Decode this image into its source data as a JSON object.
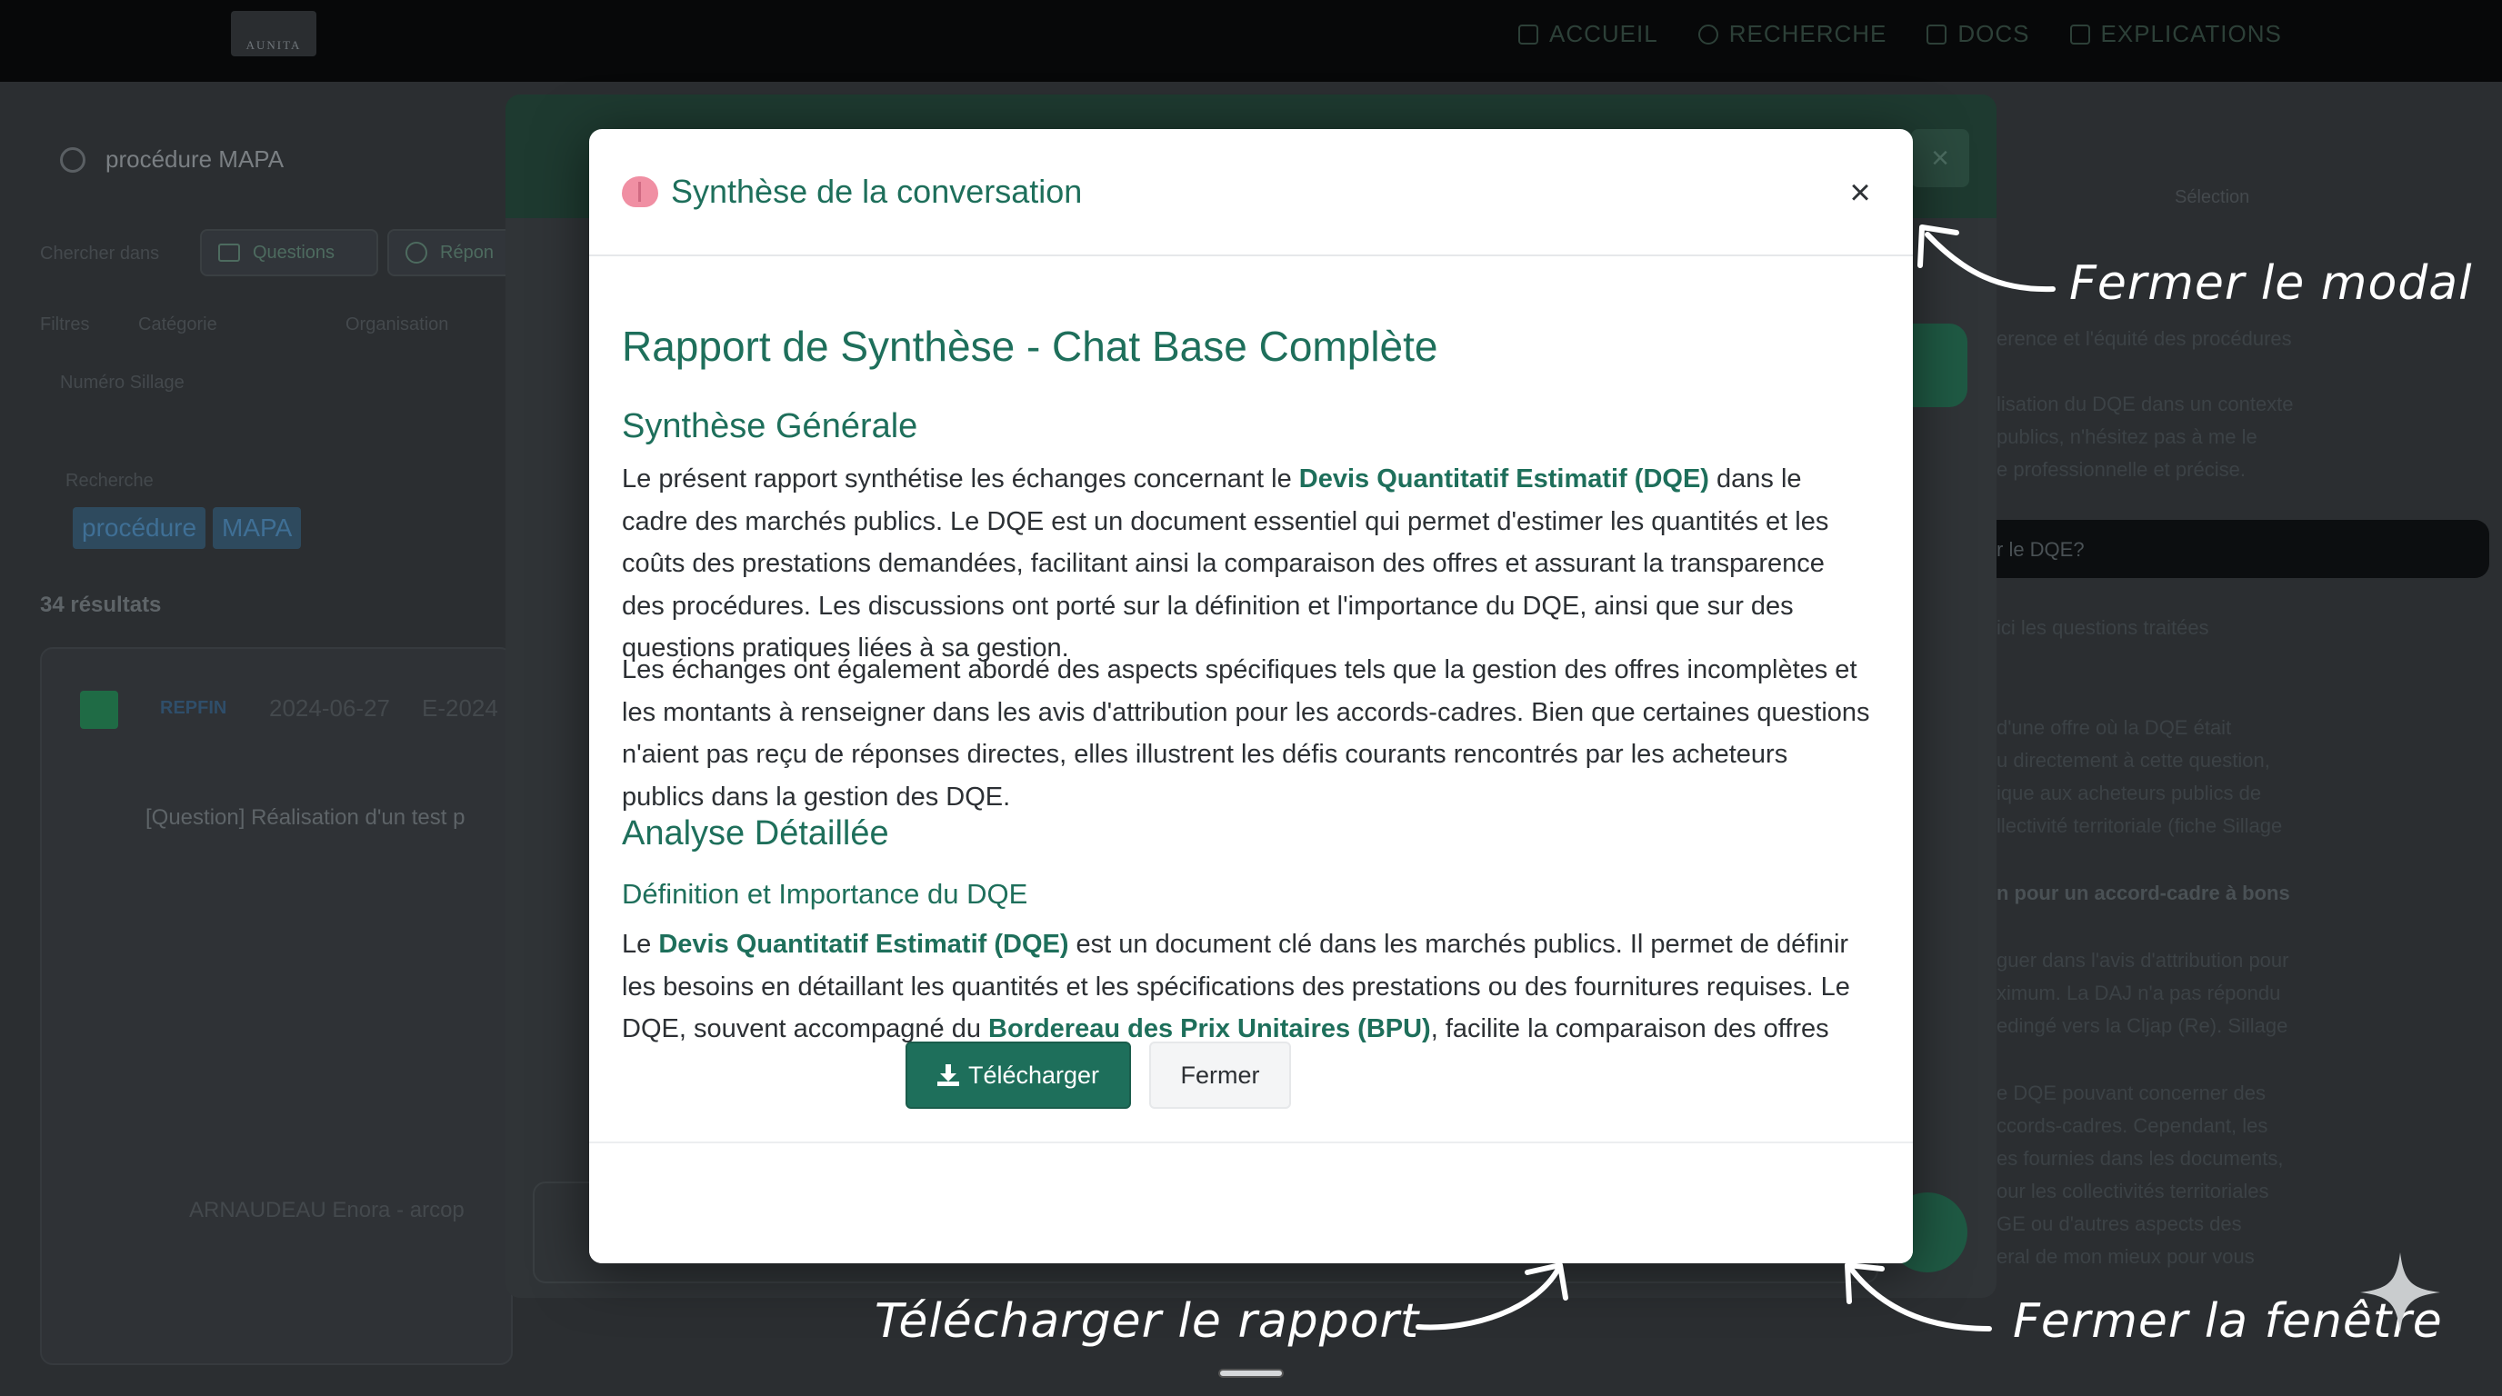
{
  "app": {
    "logo_text": "AUNITA",
    "nav": [
      {
        "label": "ACCUEIL",
        "icon": "home-icon"
      },
      {
        "label": "RECHERCHE",
        "icon": "search-icon"
      },
      {
        "label": "DOCS",
        "icon": "document-icon"
      },
      {
        "label": "EXPLICATIONS",
        "icon": "book-icon"
      }
    ]
  },
  "background": {
    "search_query": "procédure MAPA",
    "search_in_label": "Chercher dans",
    "chip_questions": "Questions",
    "chip_reponses": "Répon",
    "filters_label": "Filtres",
    "filter_category": "Catégorie",
    "filter_organisation": "Organisation",
    "filter_sillage": "Numéro Sillage",
    "search_label": "Recherche",
    "tags": [
      "procédure",
      "MAPA"
    ],
    "results_count": "34 résultats",
    "card_source": "REPFIN",
    "card_date": "2024-06-27",
    "card_ref": "E-2024",
    "card_title": "[Question] Réalisation d'un test p",
    "card_author": "ARNAUDEAU Enora - arcop",
    "selection_label": "Sélection",
    "right_text": [
      "erence et l'équité des procédures",
      "lisation du DQE dans un contexte",
      "publics, n'hésitez pas à me le",
      "e professionnelle et précise.",
      "r le DQE?",
      "ici les questions traitées",
      "d'une offre où la DQE était",
      "u directement à cette question,",
      "ique aux acheteurs publics de",
      "llectivité territoriale (fiche Sillage",
      "n pour un accord-cadre à bons",
      "guer dans l'avis d'attribution pour",
      "ximum. La DAJ n'a pas répondu",
      "edingé vers la Cljap (Re). Sillage",
      "e DQE pouvant concerner des",
      "ccords-cadres. Cependant, les",
      "es fournies dans les documents,",
      "our les collectivités territoriales",
      "GE ou d'autres aspects des",
      "eral de mon mieux pour vous"
    ]
  },
  "modal": {
    "title": "Synthèse de la conversation",
    "close_symbol": "×",
    "report_title": "Rapport de Synthèse - Chat Base Complète",
    "section1_title": "Synthèse Générale",
    "p1_a": "Le présent rapport synthétise les échanges concernant le ",
    "p1_b": "Devis Quantitatif Estimatif (DQE)",
    "p1_c": " dans le cadre des marchés publics. Le DQE est un document essentiel qui permet d'estimer les quantités et les coûts des prestations demandées, facilitant ainsi la comparaison des offres et assurant la transparence des procédures. Les discussions ont porté sur la définition et l'importance du DQE, ainsi que sur des questions pratiques liées à sa gestion.",
    "p2": "Les échanges ont également abordé des aspects spécifiques tels que la gestion des offres incomplètes et les montants à renseigner dans les avis d'attribution pour les accords-cadres. Bien que certaines questions n'aient pas reçu de réponses directes, elles illustrent les défis courants rencontrés par les acheteurs publics dans la gestion des DQE.",
    "section2_title": "Analyse Détaillée",
    "subsection1_title": "Définition et Importance du DQE",
    "p3_a": "Le ",
    "p3_b": "Devis Quantitatif Estimatif (DQE)",
    "p3_c": " est un document clé dans les marchés publics. Il permet de définir les besoins en détaillant les quantités et les spécifications des prestations ou des fournitures requises. Le DQE, souvent accompagné du ",
    "p3_d": "Bordereau des Prix Unitaires (BPU)",
    "p3_e": ", facilite la comparaison des offres",
    "download_label": "Télécharger",
    "close_label": "Fermer"
  },
  "annotations": {
    "close_modal": "Fermer le modal",
    "download_report": "Télécharger le rapport",
    "close_window": "Fermer la fenêtre"
  }
}
